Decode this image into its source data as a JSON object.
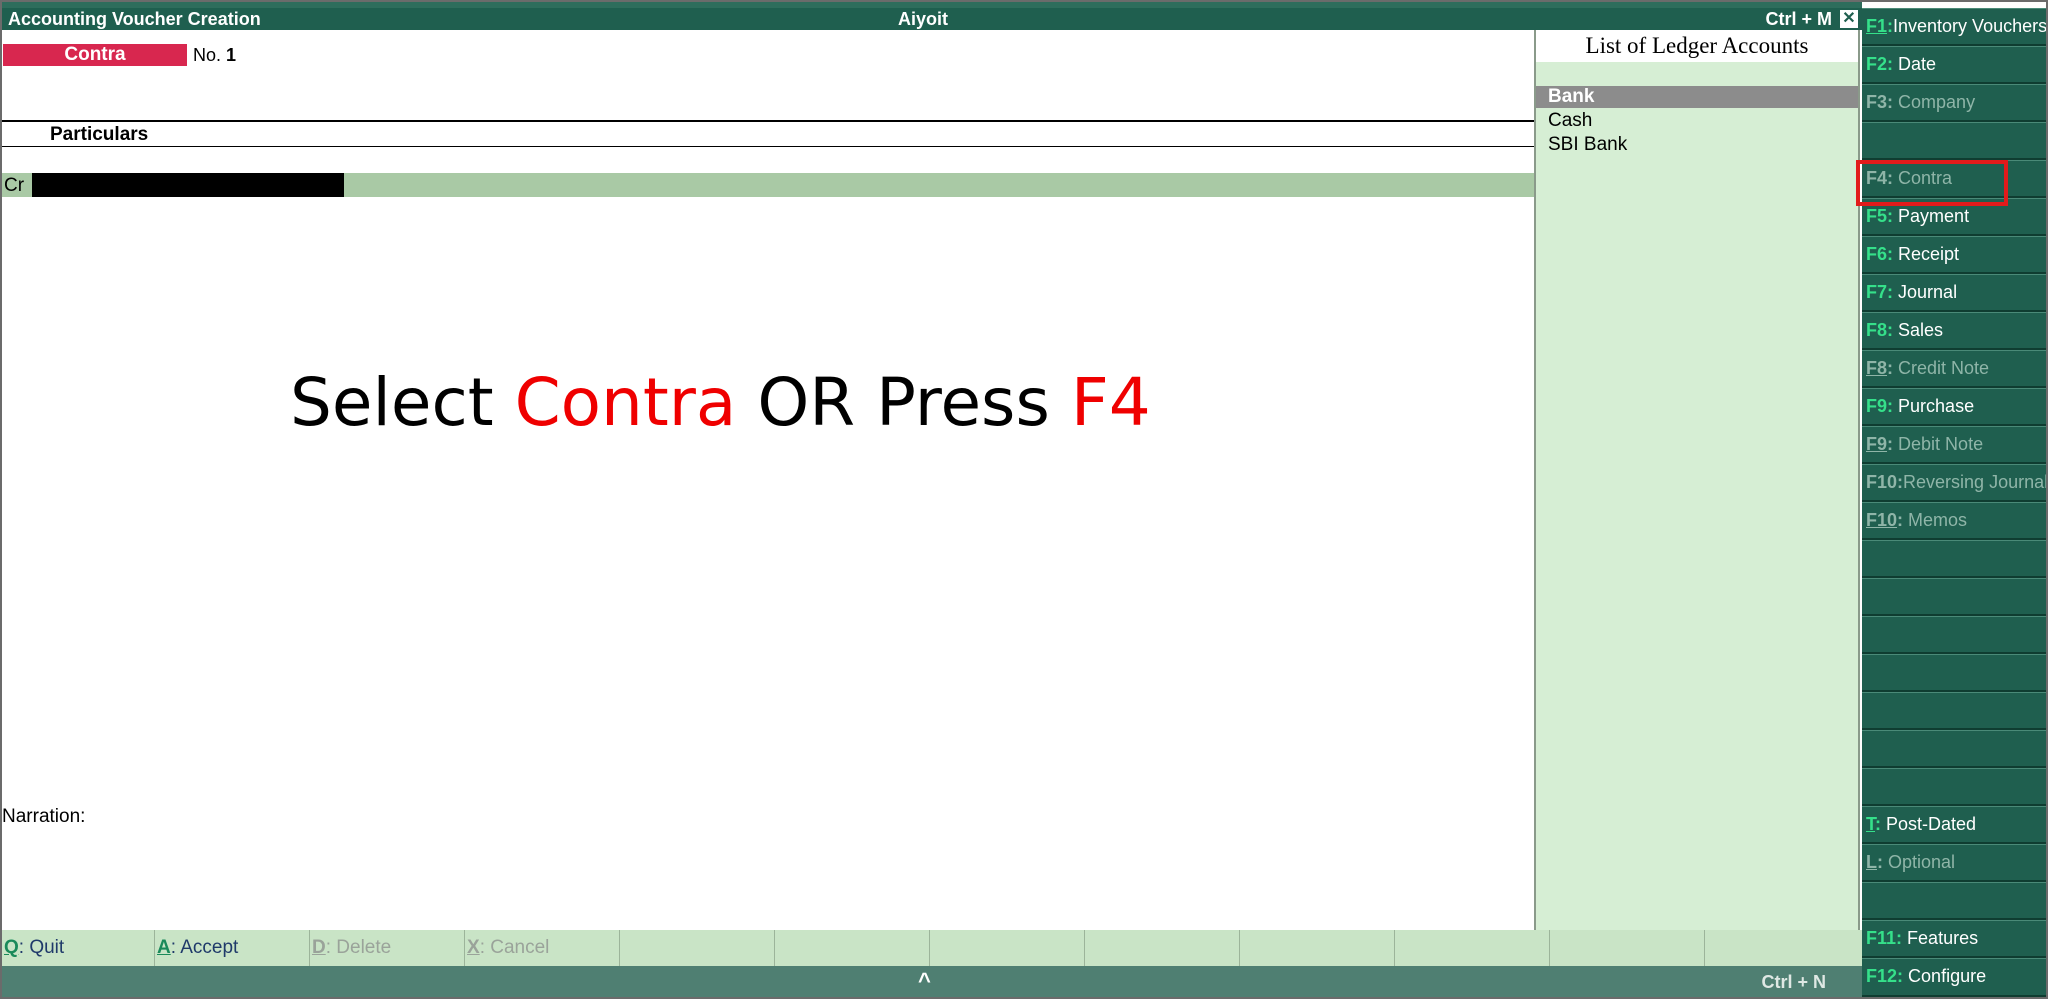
{
  "window": {
    "title": "Accounting Voucher  Creation",
    "company": "Aiyoit",
    "shortcut": "Ctrl + M",
    "close_glyph": "✕"
  },
  "voucher": {
    "type": "Contra",
    "no_label": "No.",
    "no_value": "1",
    "particulars_header": "Particulars",
    "cr_label": "Cr",
    "narration_label": "Narration:"
  },
  "instruction": {
    "part1": "Select ",
    "part2": "Contra",
    "part3": " OR Press ",
    "part4": "F4"
  },
  "ledger_list": {
    "title": "List of Ledger Accounts",
    "items": [
      "Bank",
      "Cash",
      "SBI Bank"
    ],
    "selected": "Bank"
  },
  "bottom_keys": [
    {
      "key": "Q",
      "label": ": Quit",
      "enabled": true
    },
    {
      "key": "A",
      "label": ": Accept",
      "enabled": true
    },
    {
      "key": "D",
      "label": ": Delete",
      "enabled": false
    },
    {
      "key": "X",
      "label": ": Cancel",
      "enabled": false
    }
  ],
  "statusbar": {
    "caret": "^",
    "shortcut": "Ctrl + N"
  },
  "right_buttons": [
    {
      "key": "F1",
      "label": "Inventory Vouchers",
      "enabled": true
    },
    {
      "key": "F2",
      "label": "Date",
      "enabled": true
    },
    {
      "key": "F3",
      "label": "Company",
      "enabled": false
    },
    {
      "key": "F4",
      "label": "Contra",
      "enabled": false
    },
    {
      "key": "F5",
      "label": "Payment",
      "enabled": true
    },
    {
      "key": "F6",
      "label": "Receipt",
      "enabled": true
    },
    {
      "key": "F7",
      "label": "Journal",
      "enabled": true
    },
    {
      "key": "F8",
      "label": "Sales",
      "enabled": true
    },
    {
      "key": "F8",
      "label": "Credit Note",
      "enabled": false
    },
    {
      "key": "F9",
      "label": "Purchase",
      "enabled": true
    },
    {
      "key": "F9",
      "label": "Debit Note",
      "enabled": false
    },
    {
      "key": "F10",
      "label": "Reversing Journal",
      "enabled": false
    },
    {
      "key": "F10",
      "label": "Memos",
      "enabled": false
    },
    {
      "key": "T",
      "label": "Post-Dated",
      "enabled": true
    },
    {
      "key": "L",
      "label": "Optional",
      "enabled": false
    },
    {
      "key": "F11",
      "label": "Features",
      "enabled": true
    },
    {
      "key": "F12",
      "label": "Configure",
      "enabled": true
    }
  ],
  "colors": {
    "titlebar": "#1f5f4f",
    "voucher_type_bg": "#d8274f",
    "ledger_panel_bg": "#d6eed4",
    "highlight": "#e21b1b"
  }
}
